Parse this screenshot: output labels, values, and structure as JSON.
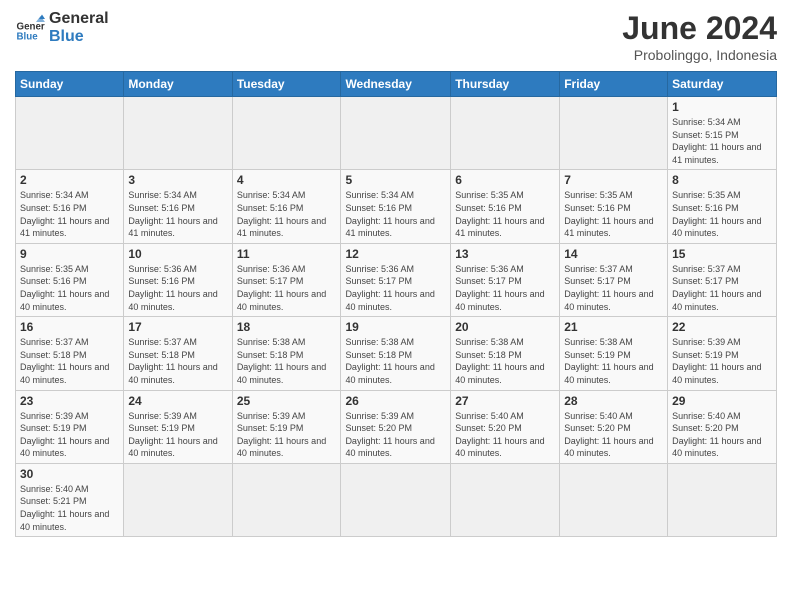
{
  "header": {
    "logo_general": "General",
    "logo_blue": "Blue",
    "month_title": "June 2024",
    "subtitle": "Probolinggo, Indonesia"
  },
  "weekdays": [
    "Sunday",
    "Monday",
    "Tuesday",
    "Wednesday",
    "Thursday",
    "Friday",
    "Saturday"
  ],
  "days": {
    "1": {
      "sunrise": "5:34 AM",
      "sunset": "5:15 PM",
      "daylight": "11 hours and 41 minutes."
    },
    "2": {
      "sunrise": "5:34 AM",
      "sunset": "5:16 PM",
      "daylight": "11 hours and 41 minutes."
    },
    "3": {
      "sunrise": "5:34 AM",
      "sunset": "5:16 PM",
      "daylight": "11 hours and 41 minutes."
    },
    "4": {
      "sunrise": "5:34 AM",
      "sunset": "5:16 PM",
      "daylight": "11 hours and 41 minutes."
    },
    "5": {
      "sunrise": "5:34 AM",
      "sunset": "5:16 PM",
      "daylight": "11 hours and 41 minutes."
    },
    "6": {
      "sunrise": "5:35 AM",
      "sunset": "5:16 PM",
      "daylight": "11 hours and 41 minutes."
    },
    "7": {
      "sunrise": "5:35 AM",
      "sunset": "5:16 PM",
      "daylight": "11 hours and 41 minutes."
    },
    "8": {
      "sunrise": "5:35 AM",
      "sunset": "5:16 PM",
      "daylight": "11 hours and 40 minutes."
    },
    "9": {
      "sunrise": "5:35 AM",
      "sunset": "5:16 PM",
      "daylight": "11 hours and 40 minutes."
    },
    "10": {
      "sunrise": "5:36 AM",
      "sunset": "5:16 PM",
      "daylight": "11 hours and 40 minutes."
    },
    "11": {
      "sunrise": "5:36 AM",
      "sunset": "5:17 PM",
      "daylight": "11 hours and 40 minutes."
    },
    "12": {
      "sunrise": "5:36 AM",
      "sunset": "5:17 PM",
      "daylight": "11 hours and 40 minutes."
    },
    "13": {
      "sunrise": "5:36 AM",
      "sunset": "5:17 PM",
      "daylight": "11 hours and 40 minutes."
    },
    "14": {
      "sunrise": "5:37 AM",
      "sunset": "5:17 PM",
      "daylight": "11 hours and 40 minutes."
    },
    "15": {
      "sunrise": "5:37 AM",
      "sunset": "5:17 PM",
      "daylight": "11 hours and 40 minutes."
    },
    "16": {
      "sunrise": "5:37 AM",
      "sunset": "5:18 PM",
      "daylight": "11 hours and 40 minutes."
    },
    "17": {
      "sunrise": "5:37 AM",
      "sunset": "5:18 PM",
      "daylight": "11 hours and 40 minutes."
    },
    "18": {
      "sunrise": "5:38 AM",
      "sunset": "5:18 PM",
      "daylight": "11 hours and 40 minutes."
    },
    "19": {
      "sunrise": "5:38 AM",
      "sunset": "5:18 PM",
      "daylight": "11 hours and 40 minutes."
    },
    "20": {
      "sunrise": "5:38 AM",
      "sunset": "5:18 PM",
      "daylight": "11 hours and 40 minutes."
    },
    "21": {
      "sunrise": "5:38 AM",
      "sunset": "5:19 PM",
      "daylight": "11 hours and 40 minutes."
    },
    "22": {
      "sunrise": "5:39 AM",
      "sunset": "5:19 PM",
      "daylight": "11 hours and 40 minutes."
    },
    "23": {
      "sunrise": "5:39 AM",
      "sunset": "5:19 PM",
      "daylight": "11 hours and 40 minutes."
    },
    "24": {
      "sunrise": "5:39 AM",
      "sunset": "5:19 PM",
      "daylight": "11 hours and 40 minutes."
    },
    "25": {
      "sunrise": "5:39 AM",
      "sunset": "5:19 PM",
      "daylight": "11 hours and 40 minutes."
    },
    "26": {
      "sunrise": "5:39 AM",
      "sunset": "5:20 PM",
      "daylight": "11 hours and 40 minutes."
    },
    "27": {
      "sunrise": "5:40 AM",
      "sunset": "5:20 PM",
      "daylight": "11 hours and 40 minutes."
    },
    "28": {
      "sunrise": "5:40 AM",
      "sunset": "5:20 PM",
      "daylight": "11 hours and 40 minutes."
    },
    "29": {
      "sunrise": "5:40 AM",
      "sunset": "5:20 PM",
      "daylight": "11 hours and 40 minutes."
    },
    "30": {
      "sunrise": "5:40 AM",
      "sunset": "5:21 PM",
      "daylight": "11 hours and 40 minutes."
    }
  },
  "labels": {
    "sunrise": "Sunrise:",
    "sunset": "Sunset:",
    "daylight": "Daylight:"
  }
}
